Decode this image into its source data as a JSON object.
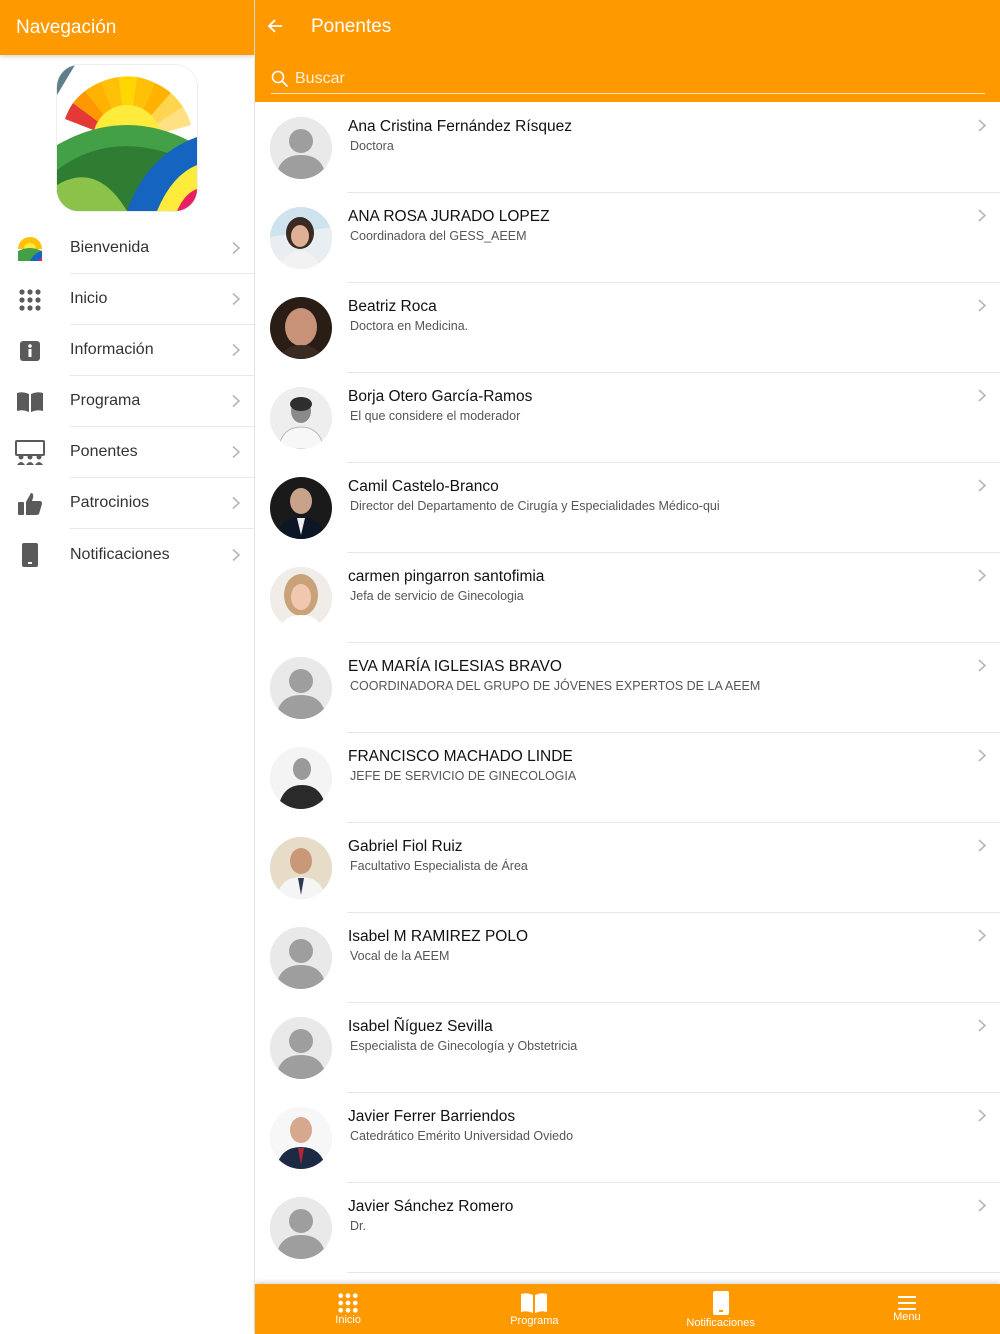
{
  "colors": {
    "accent": "#FF9900",
    "avatar_placeholder": "#9e9e9e"
  },
  "sidebar": {
    "title": "Navegación",
    "items": [
      {
        "label": "Bienvenida",
        "icon": "app-logo-icon"
      },
      {
        "label": "Inicio",
        "icon": "grid-dots-icon"
      },
      {
        "label": "Información",
        "icon": "info-icon"
      },
      {
        "label": "Programa",
        "icon": "book-icon"
      },
      {
        "label": "Ponentes",
        "icon": "speakers-icon"
      },
      {
        "label": "Patrocinios",
        "icon": "thumbs-up-icon"
      },
      {
        "label": "Notificaciones",
        "icon": "phone-icon"
      }
    ]
  },
  "header": {
    "title": "Ponentes",
    "back_icon": "arrow-left-icon"
  },
  "search": {
    "placeholder": "Buscar",
    "icon": "search-icon"
  },
  "speakers": [
    {
      "name": "Ana Cristina Fernández Rísquez",
      "role": "Doctora",
      "photo": "placeholder"
    },
    {
      "name": "ANA ROSA JURADO LOPEZ",
      "role": "Coordinadora del GESS_AEEM",
      "photo": "photo"
    },
    {
      "name": "Beatriz Roca",
      "role": "Doctora en Medicina.",
      "photo": "photo"
    },
    {
      "name": "Borja Otero García-Ramos",
      "role": "El que considere el moderador",
      "photo": "photo"
    },
    {
      "name": "Camil Castelo-Branco",
      "role": "Director del Departamento de Cirugía y Especialidades Médico-qui",
      "photo": "photo"
    },
    {
      "name": "carmen pingarron santofimia",
      "role": "Jefa de servicio de Ginecologia",
      "photo": "photo"
    },
    {
      "name": "EVA MARÍA IGLESIAS BRAVO",
      "role": "COORDINADORA DEL GRUPO DE JÓVENES EXPERTOS DE LA AEEM",
      "photo": "placeholder"
    },
    {
      "name": "FRANCISCO MACHADO LINDE",
      "role": "JEFE DE SERVICIO DE GINECOLOGIA",
      "photo": "photo"
    },
    {
      "name": "Gabriel Fiol Ruiz",
      "role": "Facultativo Especialista de Área",
      "photo": "photo"
    },
    {
      "name": "Isabel M RAMIREZ POLO",
      "role": "Vocal de la AEEM",
      "photo": "placeholder"
    },
    {
      "name": "Isabel Ñíguez Sevilla",
      "role": "Especialista de Ginecología y Obstetricia",
      "photo": "placeholder"
    },
    {
      "name": "Javier Ferrer Barriendos",
      "role": "Catedrático Emérito Universidad Oviedo",
      "photo": "photo"
    },
    {
      "name": "Javier Sánchez Romero",
      "role": "Dr.",
      "photo": "placeholder"
    }
  ],
  "bottom_nav": [
    {
      "label": "Inicio",
      "icon": "grid-dots-icon"
    },
    {
      "label": "Programa",
      "icon": "book-icon"
    },
    {
      "label": "Notificaciones",
      "icon": "phone-icon"
    },
    {
      "label": "Menu",
      "icon": "hamburger-icon"
    }
  ]
}
